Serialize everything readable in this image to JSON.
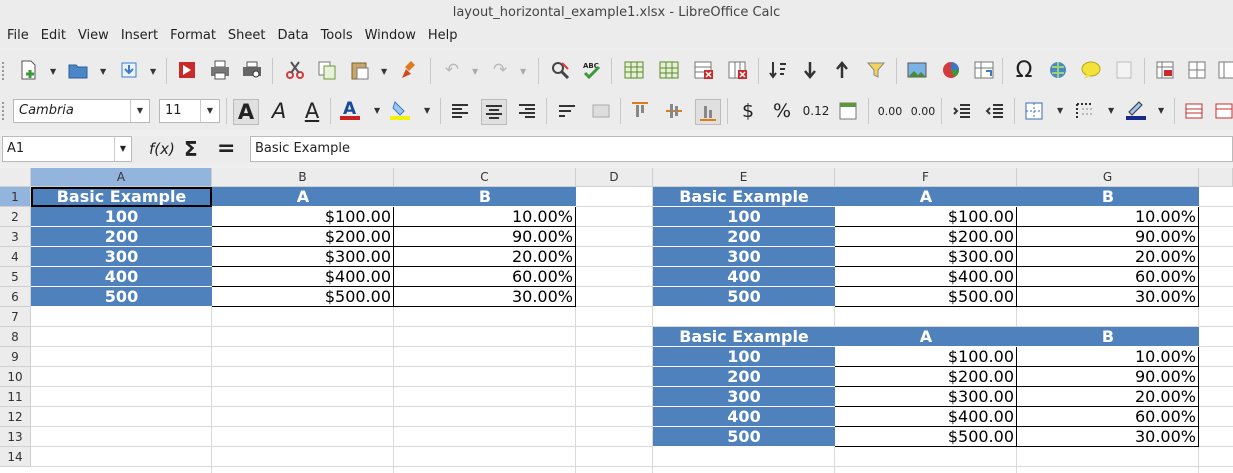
{
  "window": {
    "title": "layout_horizontal_example1.xlsx - LibreOffice Calc"
  },
  "menu": [
    "File",
    "Edit",
    "View",
    "Insert",
    "Format",
    "Sheet",
    "Data",
    "Tools",
    "Window",
    "Help"
  ],
  "toolbar2": {
    "font_name": "Cambria",
    "font_size": "11",
    "currency_symbol": "$",
    "percent_symbol": "%",
    "number_format": "0.12",
    "add_decimal": "0.00",
    "delete_decimal": "0.00"
  },
  "formula_bar": {
    "name_box": "A1",
    "function_wizard": "f(x)",
    "sum_symbol": "Σ",
    "equals_symbol": "=",
    "content": "Basic Example"
  },
  "columns": [
    "A",
    "B",
    "C",
    "D",
    "E",
    "F",
    "G"
  ],
  "rows": [
    "1",
    "2",
    "3",
    "4",
    "5",
    "6",
    "7",
    "8",
    "9",
    "10",
    "11",
    "12",
    "13",
    "14"
  ],
  "table1": {
    "headers": [
      "Basic Example",
      "A",
      "B"
    ],
    "rows": [
      [
        "100",
        "$100.00",
        "10.00%"
      ],
      [
        "200",
        "$200.00",
        "90.00%"
      ],
      [
        "300",
        "$300.00",
        "20.00%"
      ],
      [
        "400",
        "$400.00",
        "60.00%"
      ],
      [
        "500",
        "$500.00",
        "30.00%"
      ]
    ]
  },
  "table2": {
    "headers": [
      "Basic Example",
      "A",
      "B"
    ],
    "rows": [
      [
        "100",
        "$100.00",
        "10.00%"
      ],
      [
        "200",
        "$200.00",
        "90.00%"
      ],
      [
        "300",
        "$300.00",
        "20.00%"
      ],
      [
        "400",
        "$400.00",
        "60.00%"
      ],
      [
        "500",
        "$500.00",
        "30.00%"
      ]
    ]
  },
  "table3": {
    "headers": [
      "Basic Example",
      "A",
      "B"
    ],
    "rows": [
      [
        "100",
        "$100.00",
        "10.00%"
      ],
      [
        "200",
        "$200.00",
        "90.00%"
      ],
      [
        "300",
        "$300.00",
        "20.00%"
      ],
      [
        "400",
        "$400.00",
        "60.00%"
      ],
      [
        "500",
        "$500.00",
        "30.00%"
      ]
    ]
  },
  "colors": {
    "header_fill": "#4f81bd",
    "selection_header": "#93b4dd",
    "cut_red": "#d63b3b"
  },
  "icons": [
    "new-document-icon",
    "open-folder-icon",
    "save-icon",
    "export-pdf-icon",
    "print-icon",
    "print-preview-icon",
    "cut-icon",
    "copy-icon",
    "paste-icon",
    "clone-formatting-icon",
    "undo-icon",
    "redo-icon",
    "find-replace-icon",
    "spelling-icon",
    "insert-row-icon",
    "insert-column-icon",
    "delete-row-icon",
    "delete-column-icon",
    "sort-icon",
    "sort-ascending-icon",
    "sort-descending-icon",
    "autofilter-icon",
    "image-icon",
    "chart-icon",
    "pivot-table-icon",
    "special-character-icon",
    "hyperlink-icon",
    "comment-icon",
    "headers-footers-icon",
    "freeze-icon",
    "split-window-icon"
  ]
}
